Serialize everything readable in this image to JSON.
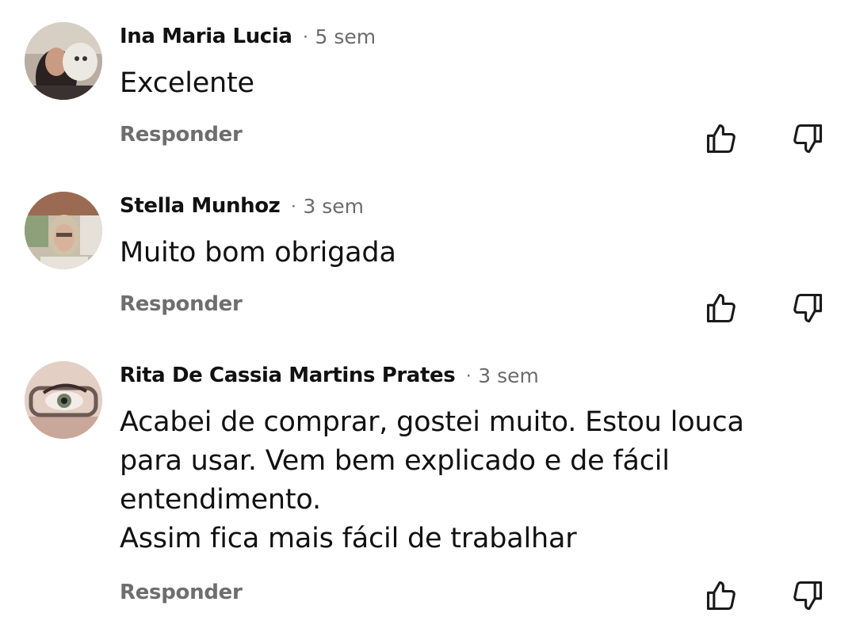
{
  "comments": [
    {
      "author": "Ina Maria Lucia",
      "separator": "·",
      "time": "5 sem",
      "text": "Excelente",
      "reply_label": "Responder",
      "avatar_icon": "avatar-photo"
    },
    {
      "author": "Stella Munhoz",
      "separator": "·",
      "time": "3 sem",
      "text": "Muito bom obrigada",
      "reply_label": "Responder",
      "avatar_icon": "avatar-photo"
    },
    {
      "author": "Rita De Cassia Martins Prates",
      "separator": "·",
      "time": "3 sem",
      "text": "Acabei de comprar, gostei muito. Estou louca\npara usar. Vem bem explicado e de fácil\nentendimento.\nAssim fica mais fácil de trabalhar",
      "reply_label": "Responder",
      "avatar_icon": "avatar-photo"
    }
  ],
  "icons": {
    "like": "thumbs-up-icon",
    "dislike": "thumbs-down-icon"
  },
  "colors": {
    "text": "#111111",
    "muted": "#6b6b6b",
    "reply": "#6e6e6e",
    "background": "#ffffff"
  }
}
